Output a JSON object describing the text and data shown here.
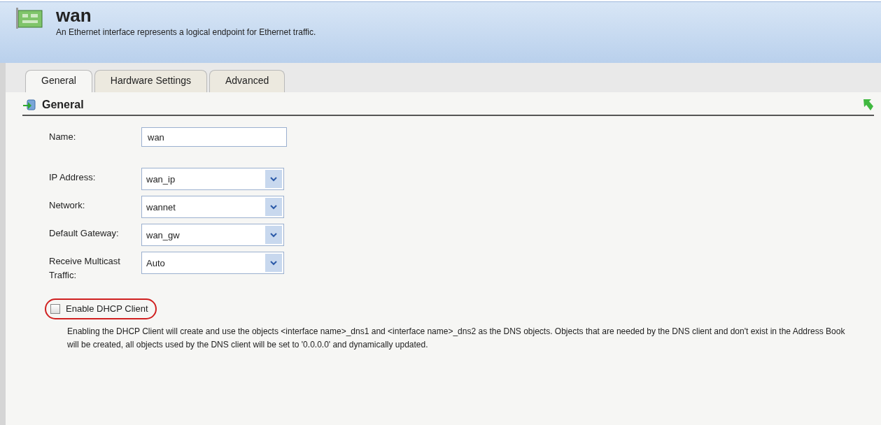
{
  "header": {
    "title": "wan",
    "subtitle": "An Ethernet interface represents a logical endpoint for Ethernet traffic."
  },
  "tabs": [
    {
      "label": "General",
      "selected": true
    },
    {
      "label": "Hardware Settings",
      "selected": false
    },
    {
      "label": "Advanced",
      "selected": false
    }
  ],
  "section": {
    "title": "General"
  },
  "fields": [
    {
      "kind": "text",
      "label": "Name:",
      "value": "wan"
    },
    {
      "kind": "select",
      "label": "IP Address:",
      "value": "wan_ip"
    },
    {
      "kind": "select",
      "label": "Network:",
      "value": "wannet"
    },
    {
      "kind": "select",
      "label": "Default Gateway:",
      "value": "wan_gw"
    },
    {
      "kind": "select",
      "label": "Receive Multicast Traffic:",
      "value": "Auto"
    }
  ],
  "dhcp": {
    "label": "Enable DHCP Client",
    "checked": false,
    "highlighted": true,
    "description": "Enabling the DHCP Client will create and use the objects <interface name>_dns1 and <interface name>_dns2 as the DNS objects. Objects that are needed by the DNS client and don't exist in the Address Book will be created, all objects used by the DNS client will be set to '0.0.0.0' and dynamically updated."
  }
}
